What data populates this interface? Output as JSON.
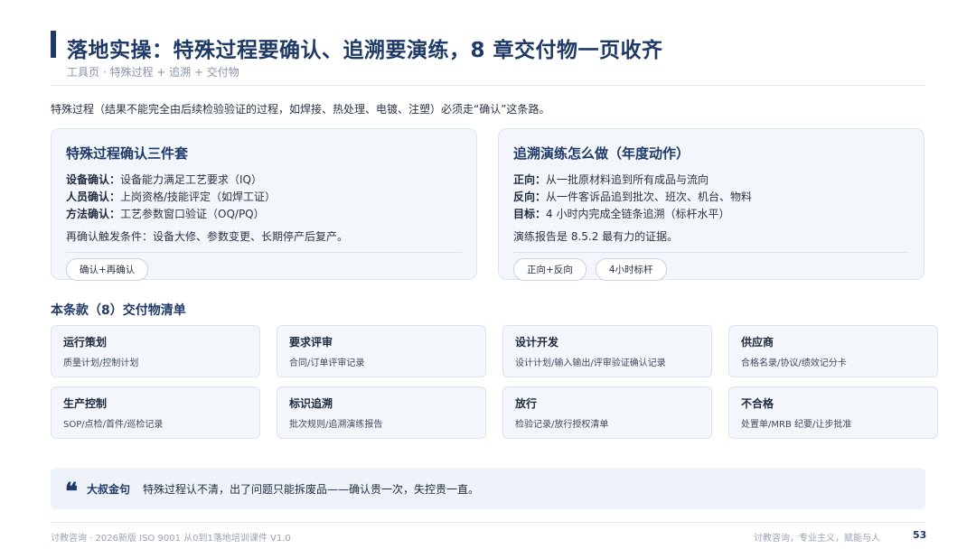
{
  "header": {
    "title": "落地实操：特殊过程要确认、追溯要演练，8 章交付物一页收齐",
    "subtitle": "工具页 · 特殊过程 + 追溯 + 交付物"
  },
  "intro": "特殊过程（结果不能完全由后续检验验证的过程，如焊接、热处理、电镀、注塑）必须走“确认”这条路。",
  "card_left": {
    "title": "特殊过程确认三件套",
    "lines": [
      {
        "label": "设备确认：",
        "text": "设备能力满足工艺要求（IQ）"
      },
      {
        "label": "人员确认：",
        "text": "上岗资格/技能评定（如焊工证）"
      },
      {
        "label": "方法确认：",
        "text": "工艺参数窗口验证（OQ/PQ）"
      }
    ],
    "note": "再确认触发条件：设备大修、参数变更、长期停产后复产。",
    "chips": [
      "确认+再确认"
    ]
  },
  "card_right": {
    "title": "追溯演练怎么做（年度动作）",
    "lines": [
      {
        "label": "正向：",
        "text": "从一批原材料追到所有成品与流向"
      },
      {
        "label": "反向：",
        "text": "从一件客诉品追到批次、班次、机台、物料"
      },
      {
        "label": "目标：",
        "text": "4 小时内完成全链条追溯（标杆水平）"
      }
    ],
    "note": "演练报告是 8.5.2 最有力的证据。",
    "chips": [
      "正向+反向",
      "4小时标杆"
    ]
  },
  "deliverables": {
    "title": "本条款（8）交付物清单",
    "items": [
      {
        "title": "运行策划",
        "desc": "质量计划/控制计划"
      },
      {
        "title": "要求评审",
        "desc": "合同/订单评审记录"
      },
      {
        "title": "设计开发",
        "desc": "设计计划/输入输出/评审验证确认记录"
      },
      {
        "title": "供应商",
        "desc": "合格名录/协议/绩效记分卡"
      },
      {
        "title": "生产控制",
        "desc": "SOP/点检/首件/巡检记录"
      },
      {
        "title": "标识追溯",
        "desc": "批次规则/追溯演练报告"
      },
      {
        "title": "放行",
        "desc": "检验记录/放行授权清单"
      },
      {
        "title": "不合格",
        "desc": "处置单/MRB 纪要/让步批准"
      }
    ]
  },
  "quote": {
    "icon": "quote-mark-icon",
    "icon_glyph": "❝",
    "label": "大叔金句",
    "text": "特殊过程认不清，出了问题只能拆废品——确认贵一次，失控贵一直。"
  },
  "footer": {
    "left": "讨教咨询 · 2026新版 ISO 9001 从0到1落地培训课件 V1.0",
    "right": "讨教咨询，专业主义，赋能与人",
    "page": "53"
  },
  "colors": {
    "accent": "#1f3a66",
    "card_bg": "#f3f7fc",
    "card_border": "#dbe4f0",
    "muted": "#8a94a6"
  }
}
